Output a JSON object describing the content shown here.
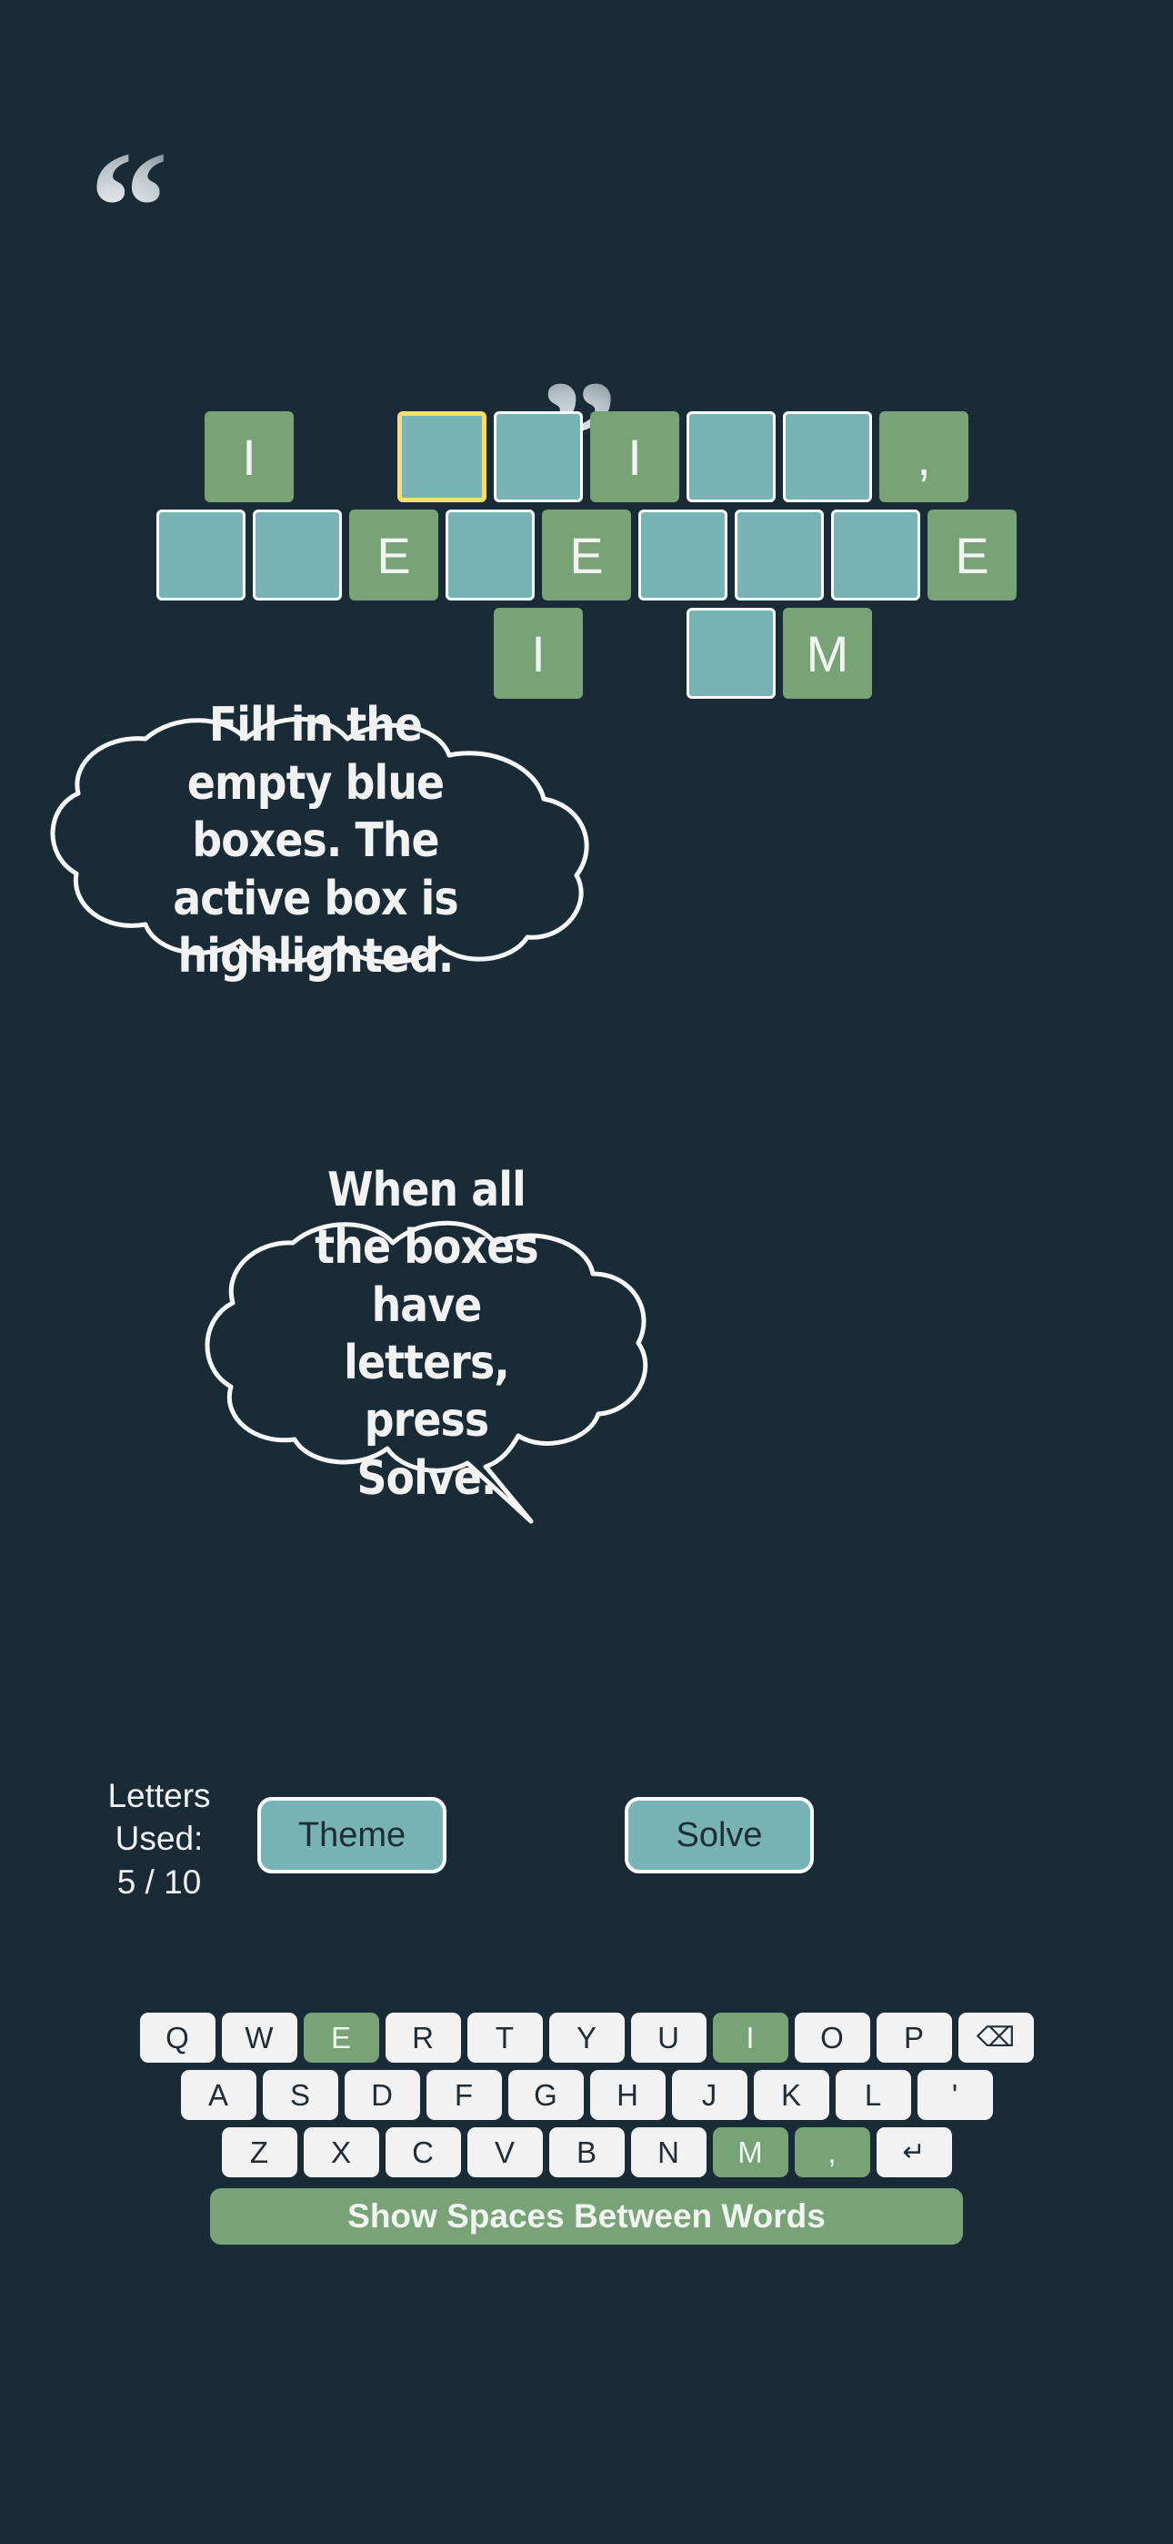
{
  "theme": {
    "background": "#1a2b38",
    "tile_blue": "#78b3b6",
    "tile_green": "#77a377",
    "active_outline": "#f7e06e",
    "text_light": "#f2f2f2",
    "key_face": "#f2f2f2"
  },
  "quotes": {
    "open": "“",
    "close": "”"
  },
  "grid": {
    "rows": [
      [
        {
          "state": "green",
          "letter": "I"
        },
        {
          "state": "gap",
          "letter": ""
        },
        {
          "state": "active",
          "letter": ""
        },
        {
          "state": "blue",
          "letter": ""
        },
        {
          "state": "green",
          "letter": "I"
        },
        {
          "state": "blue",
          "letter": ""
        },
        {
          "state": "blue",
          "letter": ""
        },
        {
          "state": "green",
          "letter": ","
        }
      ],
      [
        {
          "state": "blue",
          "letter": ""
        },
        {
          "state": "blue",
          "letter": ""
        },
        {
          "state": "green",
          "letter": "E"
        },
        {
          "state": "blue",
          "letter": ""
        },
        {
          "state": "green",
          "letter": "E"
        },
        {
          "state": "blue",
          "letter": ""
        },
        {
          "state": "blue",
          "letter": ""
        },
        {
          "state": "blue",
          "letter": ""
        },
        {
          "state": "green",
          "letter": "E"
        }
      ],
      [
        {
          "state": "gap",
          "letter": ""
        },
        {
          "state": "gap",
          "letter": ""
        },
        {
          "state": "green",
          "letter": "I"
        },
        {
          "state": "gap",
          "letter": ""
        },
        {
          "state": "blue",
          "letter": ""
        },
        {
          "state": "green",
          "letter": "M"
        }
      ]
    ]
  },
  "bubbles": [
    {
      "id": "bubble-one",
      "text": "Fill in the empty blue boxes. The active box is highlighted."
    },
    {
      "id": "bubble-two",
      "text": "When all the boxes have letters, press Solve."
    }
  ],
  "controls": {
    "letters_used_label": "Letters Used:",
    "letters_used_value": "5 / 10",
    "theme_label": "Theme",
    "solve_label": "Solve"
  },
  "keyboard": {
    "rows": [
      [
        {
          "label": "Q",
          "used": false,
          "name": "key-q"
        },
        {
          "label": "W",
          "used": false,
          "name": "key-w"
        },
        {
          "label": "E",
          "used": true,
          "name": "key-e"
        },
        {
          "label": "R",
          "used": false,
          "name": "key-r"
        },
        {
          "label": "T",
          "used": false,
          "name": "key-t"
        },
        {
          "label": "Y",
          "used": false,
          "name": "key-y"
        },
        {
          "label": "U",
          "used": false,
          "name": "key-u"
        },
        {
          "label": "I",
          "used": true,
          "name": "key-i"
        },
        {
          "label": "O",
          "used": false,
          "name": "key-o"
        },
        {
          "label": "P",
          "used": false,
          "name": "key-p"
        },
        {
          "label": "⌫",
          "used": false,
          "name": "backspace-icon",
          "icon": true
        }
      ],
      [
        {
          "label": "A",
          "used": false,
          "name": "key-a"
        },
        {
          "label": "S",
          "used": false,
          "name": "key-s"
        },
        {
          "label": "D",
          "used": false,
          "name": "key-d"
        },
        {
          "label": "F",
          "used": false,
          "name": "key-f"
        },
        {
          "label": "G",
          "used": false,
          "name": "key-g"
        },
        {
          "label": "H",
          "used": false,
          "name": "key-h"
        },
        {
          "label": "J",
          "used": false,
          "name": "key-j"
        },
        {
          "label": "K",
          "used": false,
          "name": "key-k"
        },
        {
          "label": "L",
          "used": false,
          "name": "key-l"
        },
        {
          "label": "'",
          "used": false,
          "name": "key-apostrophe"
        }
      ],
      [
        {
          "label": "Z",
          "used": false,
          "name": "key-z"
        },
        {
          "label": "X",
          "used": false,
          "name": "key-x"
        },
        {
          "label": "C",
          "used": false,
          "name": "key-c"
        },
        {
          "label": "V",
          "used": false,
          "name": "key-v"
        },
        {
          "label": "B",
          "used": false,
          "name": "key-b"
        },
        {
          "label": "N",
          "used": false,
          "name": "key-n"
        },
        {
          "label": "M",
          "used": true,
          "name": "key-m"
        },
        {
          "label": ",",
          "used": true,
          "name": "key-comma"
        },
        {
          "label": "↵",
          "used": false,
          "name": "enter-icon",
          "icon": true
        }
      ]
    ],
    "spaces_button_label": "Show Spaces Between Words"
  }
}
